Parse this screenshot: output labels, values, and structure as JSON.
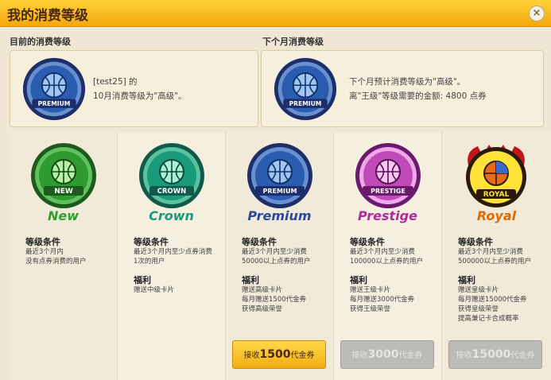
{
  "window": {
    "title": "我的消费等级",
    "close_label": "×"
  },
  "current": {
    "label": "目前的消费等级",
    "badge_text": "PREMIUM",
    "line1": "[test25] 的",
    "line2": "10月消费等级为\"高级\"。"
  },
  "next": {
    "label": "下个月消费等级",
    "badge_text": "PREMIUM",
    "line1": "下个月预计消费等级为\"高级\"。",
    "line2": "离\"王级\"等级需要的金额: 4800 点券"
  },
  "tiers": [
    {
      "name": "New",
      "badge_text": "NEW",
      "cond_title": "等级条件",
      "cond_lines": [
        "最近3个月内",
        "没有点券消费的用户"
      ],
      "ben_title": "",
      "ben_lines": [],
      "button": ""
    },
    {
      "name": "Crown",
      "badge_text": "CROWN",
      "cond_title": "等级条件",
      "cond_lines": [
        "最近3个月内至少点券消费",
        "1次的用户"
      ],
      "ben_title": "福利",
      "ben_lines": [
        "赠送中级卡片"
      ],
      "button": ""
    },
    {
      "name": "Premium",
      "badge_text": "PREMIUM",
      "cond_title": "等级条件",
      "cond_lines": [
        "最近3个月内至少消费",
        "50000以上点券的用户"
      ],
      "ben_title": "福利",
      "ben_lines": [
        "赠送高级卡片",
        "每月赠送1500代金券",
        "获得高级荣誉"
      ],
      "button": {
        "prefix": "接收",
        "amount": "1500",
        "suffix": "代金券",
        "state": "active"
      }
    },
    {
      "name": "Prestige",
      "badge_text": "PRESTIGE",
      "cond_title": "等级条件",
      "cond_lines": [
        "最近3个月内至少消费",
        "100000以上点券的用户"
      ],
      "ben_title": "福利",
      "ben_lines": [
        "赠送王级卡片",
        "每月赠送3000代金券",
        "获得王级荣誉"
      ],
      "button": {
        "prefix": "接收",
        "amount": "3000",
        "suffix": "代金券",
        "state": "disabled"
      }
    },
    {
      "name": "Royal",
      "badge_text": "ROYAL",
      "cond_title": "等级条件",
      "cond_lines": [
        "最近3个月内至少消费",
        "500000以上点券的用户"
      ],
      "ben_title": "福利",
      "ben_lines": [
        "赠送皇级卡片",
        "每月赠送15000代金券",
        "获得皇级荣誉",
        "提高兼记卡合成概率"
      ],
      "button": {
        "prefix": "接收",
        "amount": "15000",
        "suffix": "代金券",
        "state": "disabled"
      }
    }
  ],
  "colors": {
    "new": "#2fa12f",
    "crown": "#1a9a7a",
    "premium": "#2b4a9a",
    "prestige": "#b02aa0",
    "royal": "#e06a00"
  }
}
